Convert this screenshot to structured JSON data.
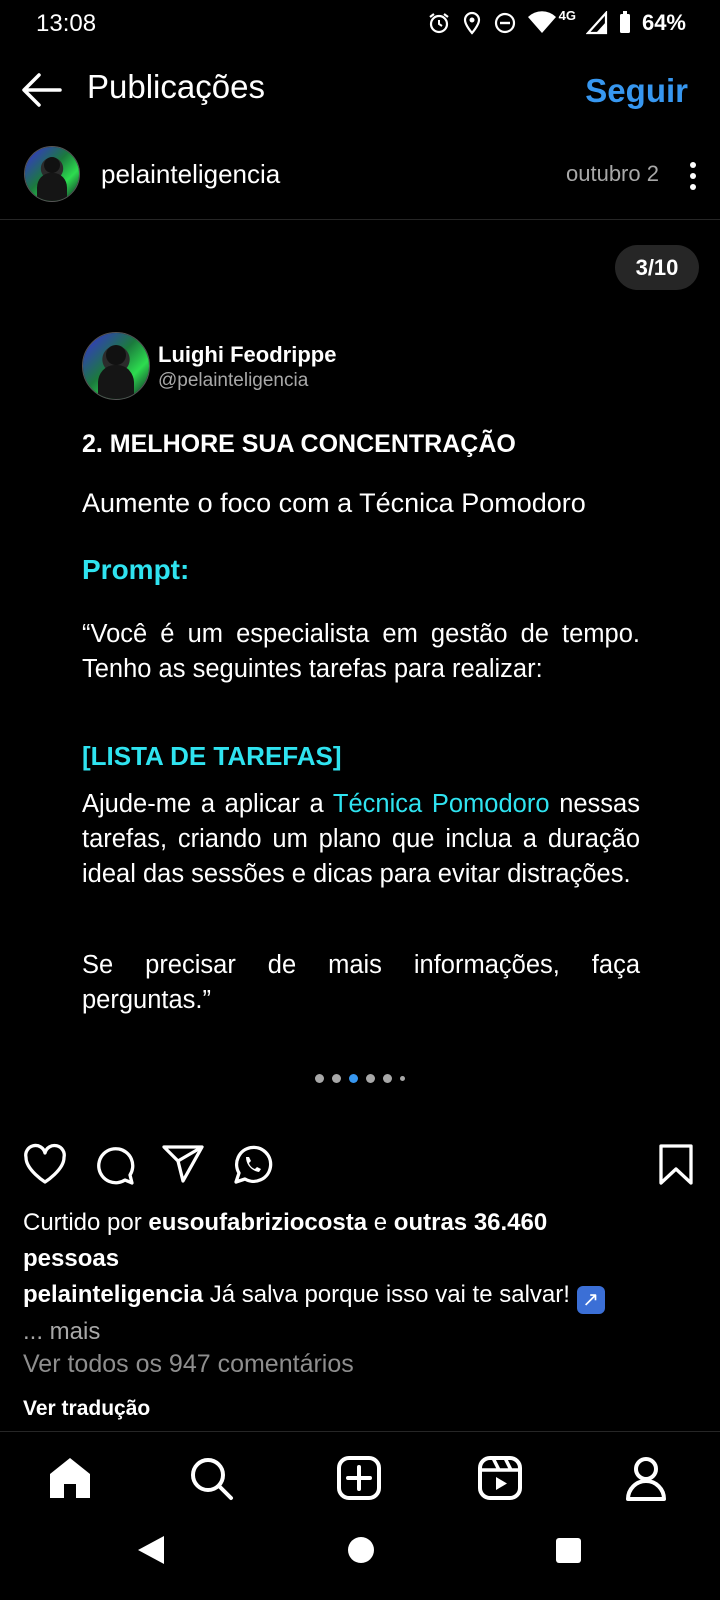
{
  "status_bar": {
    "time": "13:08",
    "network": "4G",
    "battery": "64%"
  },
  "topbar": {
    "title": "Publicações",
    "follow_label": "Seguir"
  },
  "post_header": {
    "username": "pelainteligencia",
    "date": "outubro 2"
  },
  "carousel": {
    "counter": "3/10",
    "active_index": 2,
    "dot_count": 6
  },
  "card": {
    "author_name": "Luighi Feodrippe",
    "author_handle": "@pelainteligencia",
    "heading": "2. MELHORE SUA CONCENTRAÇÃO",
    "subtitle": "Aumente o foco com a Técnica Pomodoro",
    "prompt_label": "Prompt:",
    "paragraph1": "“Você é um especialista em gestão de tempo. Tenho as seguintes tarefas para realizar:",
    "tasks_placeholder": "[LISTA DE TAREFAS]",
    "paragraph2_pre": "Ajude-me a aplicar a ",
    "paragraph2_highlight": "Técnica Pomodoro",
    "paragraph2_post": " nessas tarefas, criando um plano que inclua a duração ideal das sessões e dicas para evitar distrações.",
    "paragraph3": "Se precisar de mais informações, faça perguntas.”"
  },
  "engagement": {
    "liked_by_prefix": "Curtido por ",
    "liked_by_user": "eusoufabriziocosta",
    "liked_by_mid": " e ",
    "liked_by_others": "outras 36.460",
    "liked_by_suffix": "pessoas",
    "caption_user": "pelainteligencia",
    "caption_text": " Já salva porque isso vai te salvar! ",
    "caption_emoji": "↗",
    "caption_more": "... mais",
    "comments_link": "Ver todos os 947 comentários",
    "translate_link": "Ver tradução"
  },
  "colors": {
    "accent_blue": "#3797f0",
    "highlight_cyan": "#2fe3f0",
    "muted": "#a8a8a8"
  },
  "icons": {
    "actions": [
      "heart-icon",
      "comment-icon",
      "share-icon",
      "whatsapp-icon",
      "bookmark-icon"
    ],
    "bottom_nav": [
      "home-icon",
      "search-icon",
      "create-icon",
      "reels-icon",
      "profile-icon"
    ]
  }
}
